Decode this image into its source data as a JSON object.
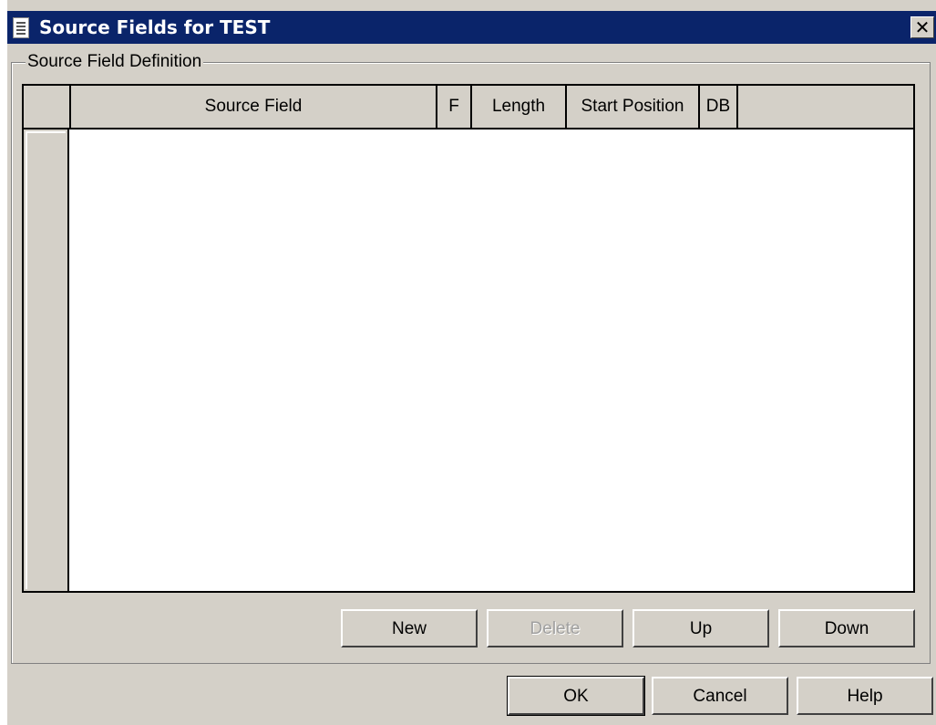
{
  "window": {
    "title": "Source Fields for TEST",
    "close_label": "✕"
  },
  "group": {
    "label": "Source Field Definition"
  },
  "grid": {
    "columns": [
      "Source Field",
      "F",
      "Length",
      "Start Position",
      "DB"
    ],
    "rows": []
  },
  "grid_buttons": {
    "new": "New",
    "delete": "Delete",
    "up": "Up",
    "down": "Down"
  },
  "dialog_buttons": {
    "ok": "OK",
    "cancel": "Cancel",
    "help": "Help"
  }
}
